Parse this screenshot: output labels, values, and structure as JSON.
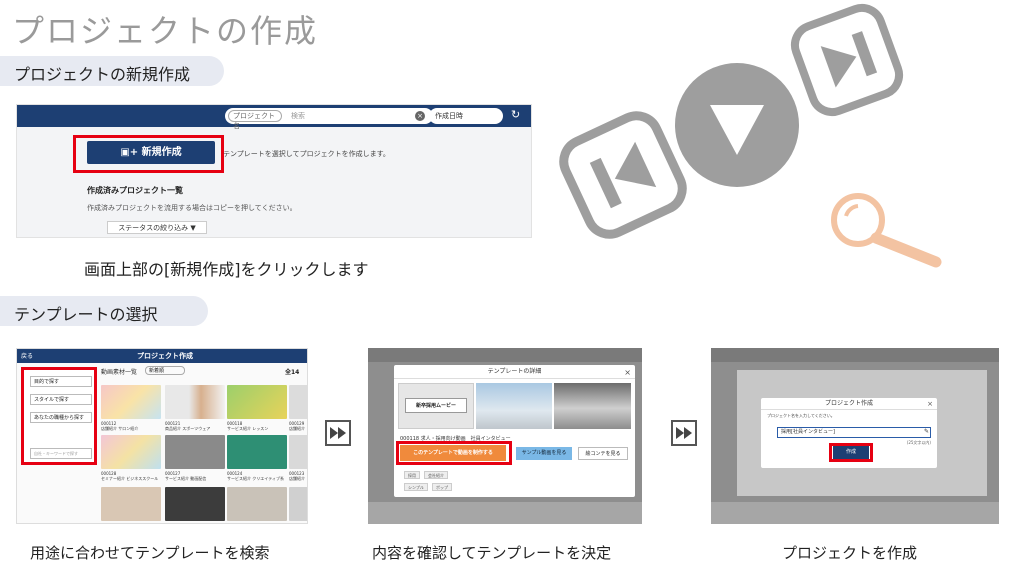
{
  "title": "プロジェクトの作成",
  "sections": {
    "new_project": "プロジェクトの新規作成",
    "template_select": "テンプレートの選択"
  },
  "shot1": {
    "search_select": "プロジェクト名",
    "search_placeholder": "検索",
    "sort_select": "作成日時",
    "new_button": "新規作成",
    "new_hint": "テンプレートを選択してプロジェクトを作成します。",
    "list_heading": "作成済みプロジェクト一覧",
    "list_desc": "作成済みプロジェクトを流用する場合はコピーを押してください。",
    "status_filter": "ステータスの絞り込み"
  },
  "caption_step1": "画面上部の[新規作成]をクリックします",
  "shot2": {
    "header_title": "プロジェクト作成",
    "back_label": "戻る",
    "list_label": "動画素材一覧",
    "list_select": "新着順",
    "count": "全14",
    "filters": [
      "目的で探す",
      "スタイルで探す",
      "あなたの職種から探す"
    ],
    "search_placeholder": "自社・キーワードで探す",
    "cards": [
      {
        "id": "000112",
        "cat": "店舗紹介",
        "sub": "サロン紹介"
      },
      {
        "id": "000121",
        "cat": "商品紹介",
        "sub": "スポーツウェア"
      },
      {
        "id": "000118",
        "cat": "サービス紹介",
        "sub": "レッスン"
      },
      {
        "id": "000129",
        "cat": "店舗紹介",
        "sub": ""
      },
      {
        "id": "000128",
        "cat": "セミナー紹介",
        "sub": "ビジネススクール"
      },
      {
        "id": "000127",
        "cat": "サービス紹介",
        "sub": "動画配信"
      },
      {
        "id": "000124",
        "cat": "サービス紹介",
        "sub": "クリエイティブ系"
      },
      {
        "id": "000123",
        "cat": "店舗紹介",
        "sub": ""
      }
    ]
  },
  "shot3": {
    "modal_title": "テンプレートの詳細",
    "movie_title": "新卒採用ムービー",
    "template_name": "000118 求人・採用向け動画　社員インタビュー",
    "primary_button": "このテンプレートで動画を制作する",
    "sample_button": "サンプル動画を見る",
    "template_button": "絵コンテを見る",
    "tags": [
      "採用",
      "会社紹介",
      "シンプル",
      "ポップ"
    ]
  },
  "shot4": {
    "modal_title": "プロジェクト作成",
    "label": "プロジェクト名を入力してください。",
    "input_value": "採用[社員インタビュー]",
    "char_count": "(25文字以内)",
    "create_button": "作成"
  },
  "captions": {
    "step2": "用途に合わせてテンプレートを検索",
    "step3": "内容を確認してテンプレートを決定",
    "step4": "プロジェクトを作成"
  },
  "colors": {
    "navy": "#1d3f73",
    "highlight_red": "#e60012",
    "accent_orange": "#f08a3c",
    "deco_gray": "#9e9e9e",
    "deco_orange": "#f3c3a2"
  },
  "icons": [
    "play-icon",
    "skip-back-icon",
    "skip-forward-icon",
    "search-icon",
    "fast-forward-icon"
  ]
}
